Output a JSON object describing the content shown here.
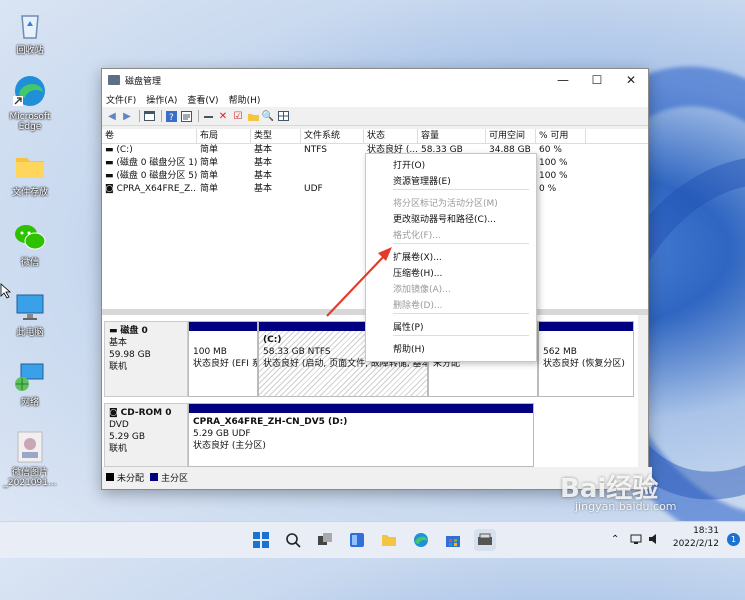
{
  "desktop": {
    "icons": [
      {
        "label": "回收站"
      },
      {
        "label": "Microsoft Edge"
      },
      {
        "label": "文件存放"
      },
      {
        "label": "微信"
      },
      {
        "label": "此电脑"
      },
      {
        "label": "网络"
      },
      {
        "label": "微信图片_2021091..."
      }
    ]
  },
  "window": {
    "title": "磁盘管理",
    "controls": {
      "minimize": "—",
      "maximize": "☐",
      "close": "✕"
    }
  },
  "menubar": [
    "文件(F)",
    "操作(A)",
    "查看(V)",
    "帮助(H)"
  ],
  "volumes": {
    "headers": [
      "卷",
      "布局",
      "类型",
      "文件系统",
      "状态",
      "容量",
      "可用空间",
      "% 可用"
    ],
    "rows": [
      [
        "(C:)",
        "简单",
        "基本",
        "NTFS",
        "状态良好 (...",
        "58.33 GB",
        "34.88 GB",
        "60 %"
      ],
      [
        "(磁盘 0 磁盘分区 1)",
        "简单",
        "基本",
        "",
        "",
        "",
        "",
        "100 %"
      ],
      [
        "(磁盘 0 磁盘分区 5)",
        "简单",
        "基本",
        "",
        "",
        "",
        "",
        "100 %"
      ],
      [
        "CPRA_X64FRE_Z...",
        "简单",
        "基本",
        "UDF",
        "",
        "",
        "",
        "0 %"
      ]
    ]
  },
  "disks": {
    "disk0": {
      "name": "磁盘 0",
      "type": "基本",
      "size": "59.98 GB",
      "status": "联机",
      "partitions": [
        {
          "title": "",
          "size": "100 MB",
          "status": "状态良好 (EFI 系"
        },
        {
          "title": "(C:)",
          "size": "58.33 GB NTFS",
          "status": "状态良好 (启动, 页面文件, 故障转储, 基本"
        },
        {
          "title": "",
          "size": "",
          "status": "未分配"
        },
        {
          "title": "",
          "size": "562 MB",
          "status": "状态良好 (恢复分区)"
        }
      ]
    },
    "cdrom": {
      "name": "CD-ROM 0",
      "type": "DVD",
      "size": "5.29 GB",
      "status": "联机",
      "partition": {
        "title": "CPRA_X64FRE_ZH-CN_DV5  (D:)",
        "size": "5.29 GB UDF",
        "status": "状态良好 (主分区)"
      }
    }
  },
  "legend": [
    "未分配",
    "主分区"
  ],
  "context_menu": {
    "items": [
      {
        "label": "打开(O)",
        "enabled": true
      },
      {
        "label": "资源管理器(E)",
        "enabled": true
      },
      {
        "label": "将分区标记为活动分区(M)",
        "enabled": false
      },
      {
        "label": "更改驱动器号和路径(C)...",
        "enabled": true
      },
      {
        "label": "格式化(F)...",
        "enabled": false
      },
      {
        "label": "扩展卷(X)...",
        "enabled": true
      },
      {
        "label": "压缩卷(H)...",
        "enabled": true
      },
      {
        "label": "添加镜像(A)...",
        "enabled": false
      },
      {
        "label": "删除卷(D)...",
        "enabled": false
      },
      {
        "label": "属性(P)",
        "enabled": true
      },
      {
        "label": "帮助(H)",
        "enabled": true
      }
    ]
  },
  "taskbar": {
    "time": "18:31",
    "date": "2022/2/12",
    "notification_count": "1"
  },
  "watermark": {
    "brand": "Bai经验",
    "url": "jingyan.baidu.com"
  },
  "colors": {
    "primary_partition": "#000080",
    "unallocated": "#000000",
    "annotation_arrow": "#e53a2a"
  }
}
